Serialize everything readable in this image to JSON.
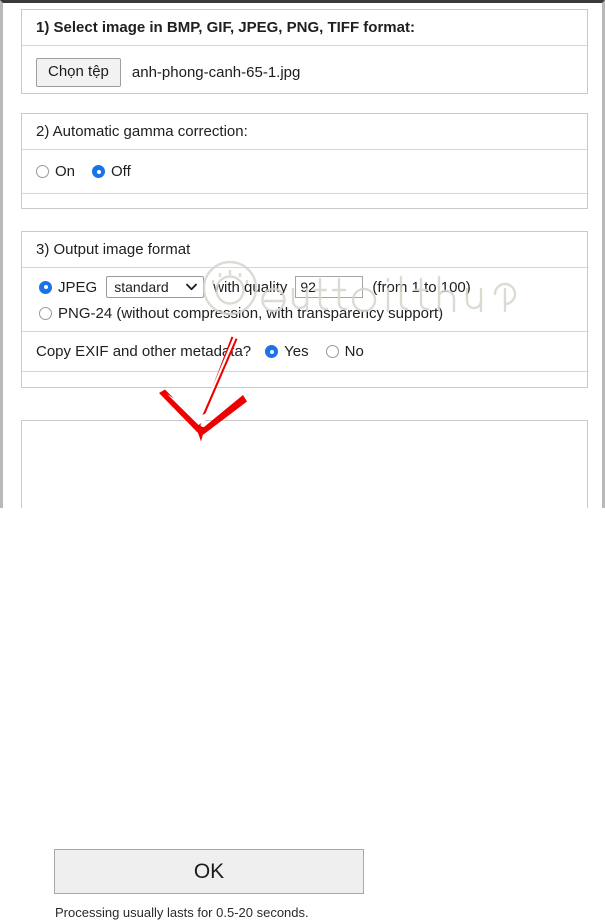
{
  "sections": [
    {
      "id": "select-image",
      "heading": "1) Select image in BMP, GIF, JPEG, PNG, TIFF format:",
      "file_button_label": "Chọn tệp",
      "file_name": "anh-phong-canh-65-1.jpg"
    },
    {
      "id": "gamma",
      "heading": "2) Automatic gamma correction:",
      "options": [
        {
          "label": "On",
          "checked": false
        },
        {
          "label": "Off",
          "checked": true
        }
      ]
    },
    {
      "id": "output-format",
      "heading": "3) Output image format",
      "jpeg": {
        "radio_checked": true,
        "label": "JPEG",
        "profile_selected": "standard",
        "quality_prefix": "with quality",
        "quality_value": "92",
        "quality_hint": "(from 1 to 100)",
        "caret_icon": "chevron-down-icon"
      },
      "png": {
        "radio_checked": false,
        "label": "PNG-24 (without compression, with transparency support)"
      },
      "exif": {
        "question": "Copy EXIF and other metadata?",
        "options": [
          {
            "label": "Yes",
            "checked": true
          },
          {
            "label": "No",
            "checked": false
          }
        ]
      }
    }
  ],
  "submit": {
    "ok_label": "OK",
    "note": "Processing usually lasts for 0.5-20 seconds."
  },
  "annotation": {
    "arrow_icon": "red-arrow-pointing-down"
  },
  "watermark": {
    "icon": "watermark-logo-icon"
  },
  "colors": {
    "accent": "#1a73e8",
    "annotation": "#ee0000",
    "border": "#c9c9c9",
    "button_face": "#efefef"
  }
}
